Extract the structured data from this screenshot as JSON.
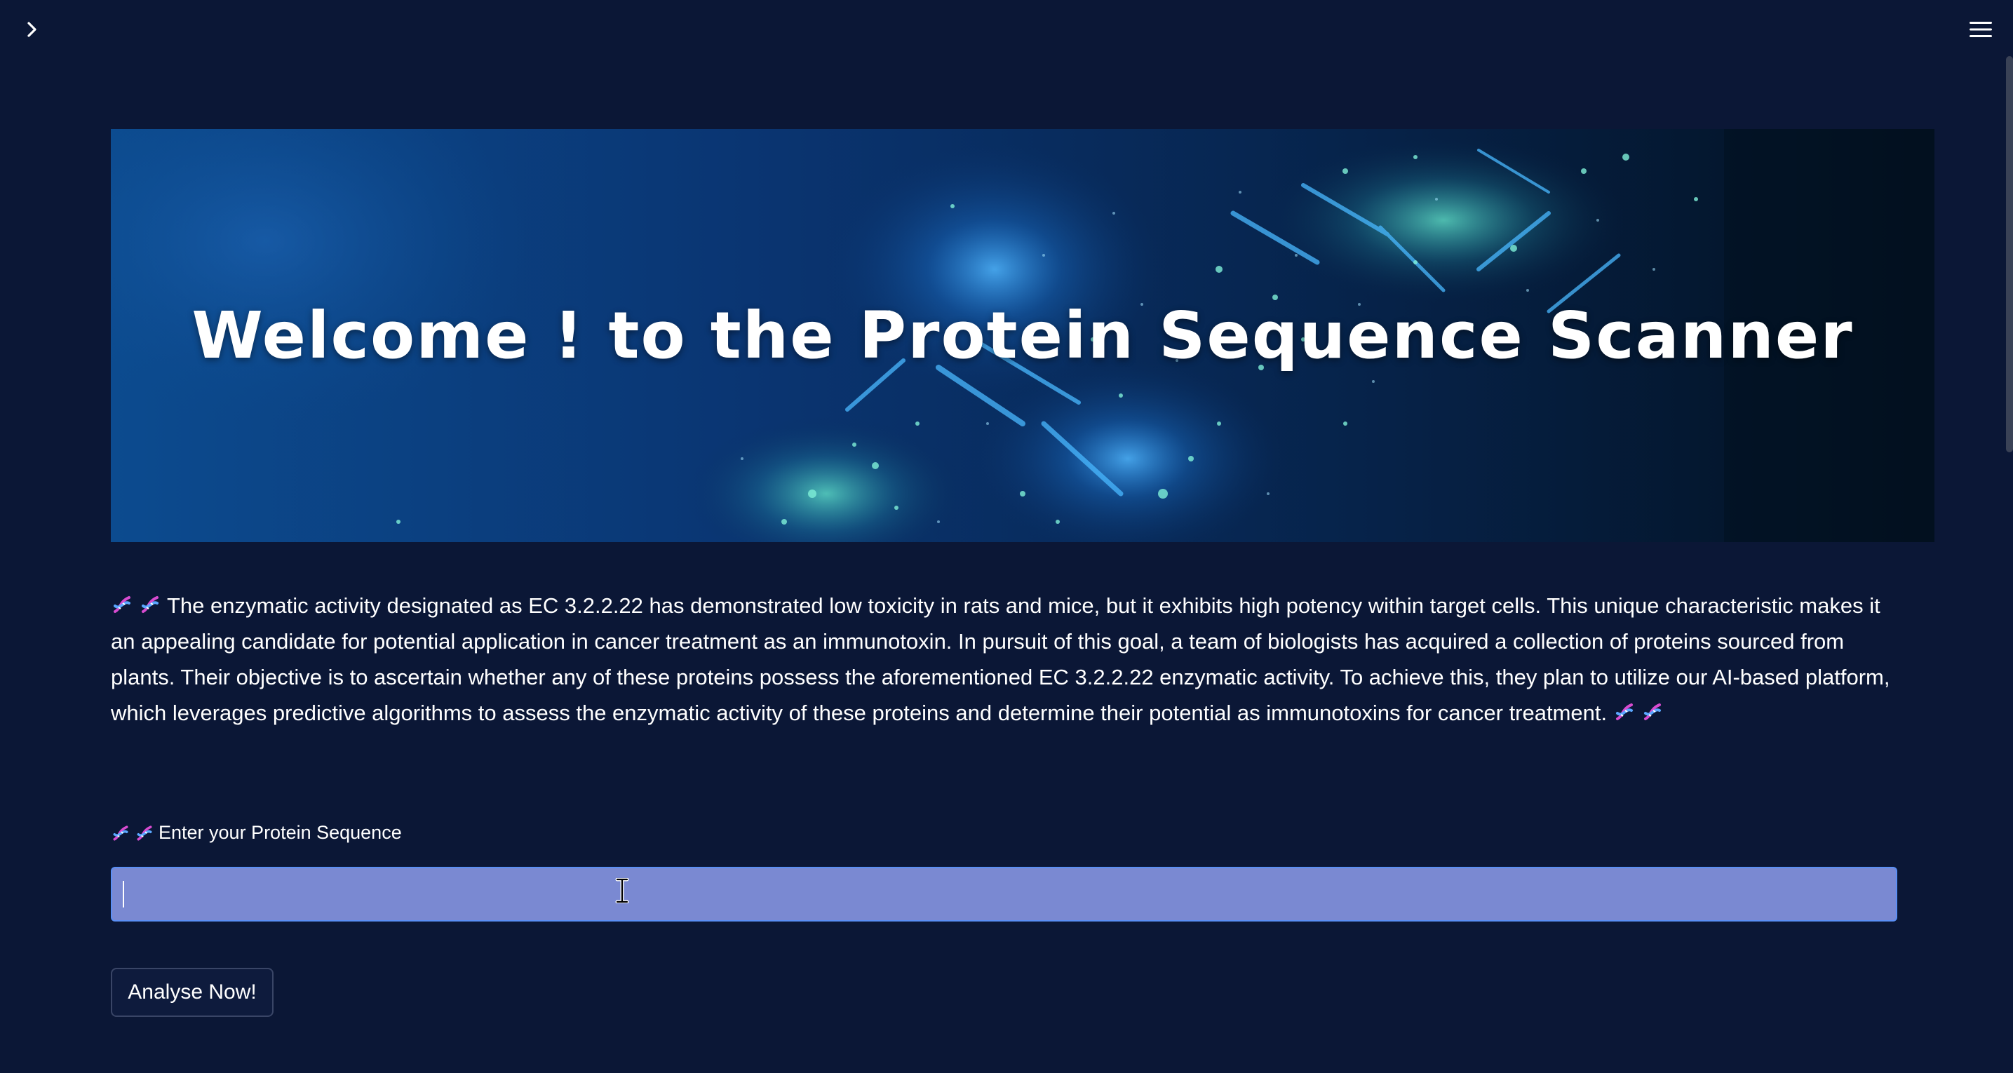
{
  "banner": {
    "title": "Welcome ! to the Protein Sequence Scanner"
  },
  "description": {
    "text": "The enzymatic activity designated as EC 3.2.2.22 has demonstrated low toxicity in rats and mice, but it exhibits high potency within target cells. This unique characteristic makes it an appealing candidate for potential application in cancer treatment as an immunotoxin. In pursuit of this goal, a team of biologists has acquired a collection of proteins sourced from plants. Their objective is to ascertain whether any of these proteins possess the aforementioned EC 3.2.2.22 enzymatic activity. To achieve this, they plan to utilize our AI-based platform, which leverages predictive algorithms to assess the enzymatic activity of these proteins and determine their potential as immunotoxins for cancer treatment."
  },
  "sequence_input": {
    "label": "Enter your Protein Sequence",
    "value": ""
  },
  "analyse_button": {
    "label": "Analyse Now!"
  },
  "icons": {
    "sidebar_toggle": "chevron-right-icon",
    "menu": "hamburger-menu-icon",
    "emoji": "dna-emoji-icon"
  },
  "colors": {
    "background": "#0b1736",
    "input_fill": "#7a89d2",
    "input_border": "#5b8ff5",
    "button_border": "#394566"
  }
}
